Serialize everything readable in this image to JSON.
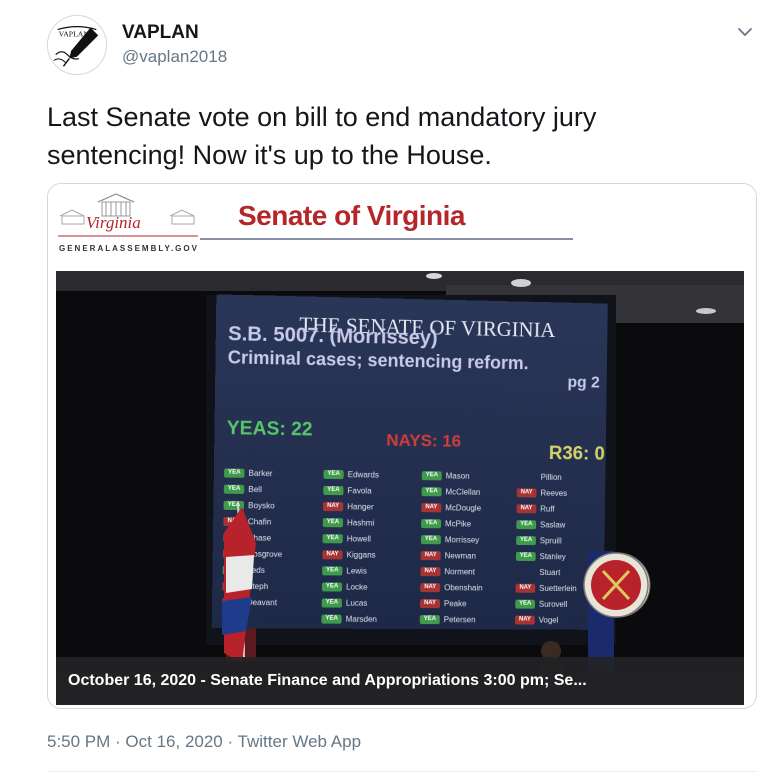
{
  "author": {
    "display_name": "VAPLAN",
    "handle": "@vaplan2018",
    "avatar_icon": "fountain-pen-logo-icon",
    "avatar_logo_text": "VAPLAN"
  },
  "tweet": {
    "text_line1": "Last Senate vote on bill to end mandatory jury",
    "text_line2": "sentencing! Now it's up to the House."
  },
  "card": {
    "banner_logo_text": "Virginia",
    "banner_site": "GENERALASSEMBLY.GOV",
    "banner_title": "Senate of Virginia",
    "video_caption": "October 16, 2020 - Senate Finance and Appropriations 3:00 pm; Se...",
    "board": {
      "heading": "THE SENATE OF VIRGINIA",
      "bill": "S.B. 5007. (Morrissey)",
      "subject": "Criminal cases; sentencing reform.",
      "page": "pg 2",
      "yeas": "YEAS: 22",
      "nays": "NAYS: 16",
      "rule": "R36: 0",
      "columns": [
        [
          {
            "tag": "YEA",
            "name": "Barker"
          },
          {
            "tag": "YEA",
            "name": "Bell"
          },
          {
            "tag": "YEA",
            "name": "Boysko"
          },
          {
            "tag": "NAY",
            "name": "Chafin"
          },
          {
            "tag": "NAY",
            "name": "Chase"
          },
          {
            "tag": "NAY",
            "name": "Cosgrove"
          },
          {
            "tag": "YEA",
            "name": "eeds"
          },
          {
            "tag": "NAY",
            "name": "Steph"
          },
          {
            "tag": "NAY",
            "name": "Deavant"
          },
          {
            "tag": "",
            "name": ""
          }
        ],
        [
          {
            "tag": "YEA",
            "name": "Edwards"
          },
          {
            "tag": "YEA",
            "name": "Favola"
          },
          {
            "tag": "NAY",
            "name": "Hanger"
          },
          {
            "tag": "YEA",
            "name": "Hashmi"
          },
          {
            "tag": "YEA",
            "name": "Howell"
          },
          {
            "tag": "NAY",
            "name": "Kiggans"
          },
          {
            "tag": "YEA",
            "name": "Lewis"
          },
          {
            "tag": "YEA",
            "name": "Locke"
          },
          {
            "tag": "YEA",
            "name": "Lucas"
          },
          {
            "tag": "YEA",
            "name": "Marsden"
          }
        ],
        [
          {
            "tag": "YEA",
            "name": "Mason"
          },
          {
            "tag": "YEA",
            "name": "McClellan"
          },
          {
            "tag": "NAY",
            "name": "McDougle"
          },
          {
            "tag": "YEA",
            "name": "McPike"
          },
          {
            "tag": "YEA",
            "name": "Morrissey"
          },
          {
            "tag": "NAY",
            "name": "Newman"
          },
          {
            "tag": "NAY",
            "name": "Norment"
          },
          {
            "tag": "NAY",
            "name": "Obenshain"
          },
          {
            "tag": "NAY",
            "name": "Peake"
          },
          {
            "tag": "YEA",
            "name": "Petersen"
          }
        ],
        [
          {
            "tag": "",
            "name": "Pillion"
          },
          {
            "tag": "NAY",
            "name": "Reeves"
          },
          {
            "tag": "NAY",
            "name": "Ruff"
          },
          {
            "tag": "YEA",
            "name": "Saslaw"
          },
          {
            "tag": "YEA",
            "name": "Spruill"
          },
          {
            "tag": "YEA",
            "name": "Stanley"
          },
          {
            "tag": "",
            "name": "Stuart"
          },
          {
            "tag": "NAY",
            "name": "Suetterlein"
          },
          {
            "tag": "YEA",
            "name": "Surovell"
          },
          {
            "tag": "NAY",
            "name": "Vogel"
          }
        ]
      ]
    }
  },
  "timestamp": "5:50 PM · Oct 16, 2020 · Twitter Web App",
  "colors": {
    "text": "#14171a",
    "secondary": "#657786",
    "senate_red": "#b5262b",
    "yeas_green": "#55c76a",
    "nays_red": "#cf3e3e"
  }
}
